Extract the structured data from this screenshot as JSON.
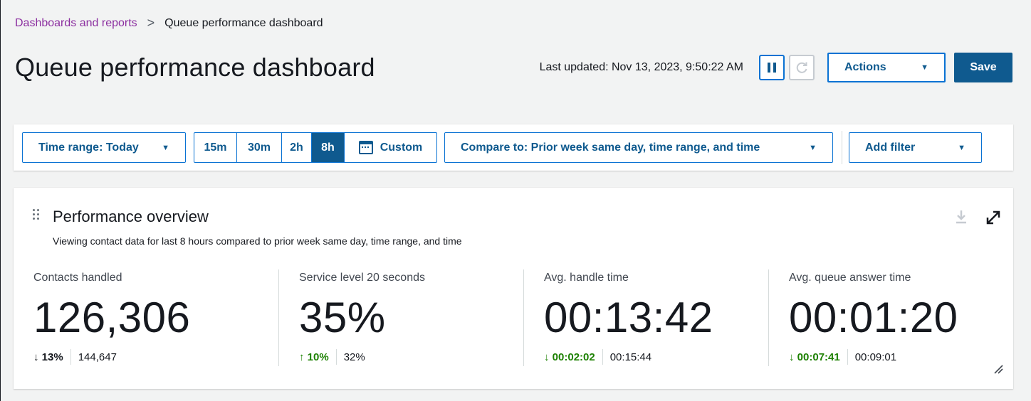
{
  "breadcrumb": {
    "parent": "Dashboards and reports",
    "separator": ">",
    "current": "Queue performance dashboard"
  },
  "header": {
    "title": "Queue performance dashboard",
    "last_updated": "Last updated: Nov 13, 2023, 9:50:22 AM",
    "actions_label": "Actions",
    "save_label": "Save"
  },
  "filters": {
    "time_range_label": "Time range: Today",
    "intervals": [
      "15m",
      "30m",
      "2h",
      "8h"
    ],
    "selected_interval": "8h",
    "custom_label": "Custom",
    "compare_label": "Compare to: Prior week same day, time range, and time",
    "add_filter_label": "Add filter"
  },
  "panel": {
    "title": "Performance overview",
    "subtitle": "Viewing contact data for last 8 hours compared to prior week same day, time range, and time",
    "metrics": [
      {
        "label": "Contacts handled",
        "value": "126,306",
        "delta": "↓ 13%",
        "delta_status": "neutral",
        "prior": "144,647"
      },
      {
        "label": "Service level 20 seconds",
        "value": "35%",
        "delta": "↑ 10%",
        "delta_status": "good",
        "prior": "32%"
      },
      {
        "label": "Avg. handle time",
        "value": "00:13:42",
        "delta": "↓ 00:02:02",
        "delta_status": "good",
        "prior": "00:15:44"
      },
      {
        "label": "Avg. queue answer time",
        "value": "00:01:20",
        "delta": "↓ 00:07:41",
        "delta_status": "good",
        "prior": "00:09:01"
      }
    ]
  },
  "colors": {
    "link_purple": "#8c2fa0",
    "primary_blue": "#0f5a8f",
    "border_blue": "#0972d3",
    "positive_green": "#1d8102",
    "background": "#f2f3f3"
  },
  "icons": {
    "pause": "pause-icon",
    "refresh": "refresh-icon",
    "dropdown": "caret-down-icon",
    "calendar": "calendar-icon",
    "drag": "drag-handle-icon",
    "download": "download-icon",
    "expand": "expand-icon",
    "resize": "resize-handle-icon"
  }
}
